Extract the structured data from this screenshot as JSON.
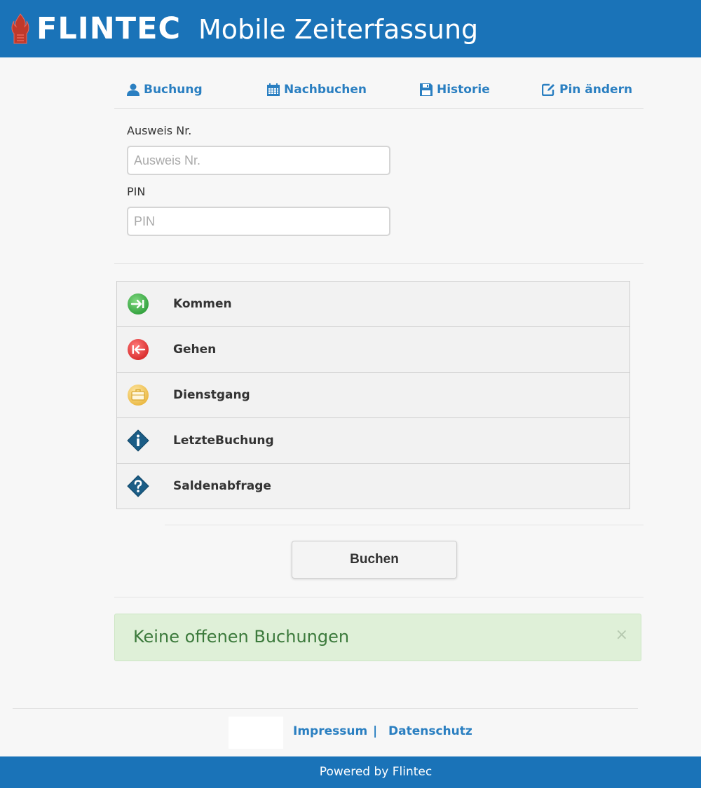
{
  "header": {
    "logo_text": "FLINTEC",
    "title": "Mobile Zeiterfassung",
    "bg_color": "#1a73b8"
  },
  "tabs": [
    {
      "label": "Buchung",
      "icon": "user-icon"
    },
    {
      "label": "Nachbuchen",
      "icon": "calendar-icon"
    },
    {
      "label": "Historie",
      "icon": "save-icon"
    },
    {
      "label": "Pin ändern",
      "icon": "edit-icon"
    }
  ],
  "form": {
    "ausweis": {
      "label": "Ausweis Nr.",
      "placeholder": "Ausweis Nr.",
      "value": ""
    },
    "pin": {
      "label": "PIN",
      "placeholder": "PIN",
      "value": ""
    }
  },
  "options": [
    {
      "label": "Kommen",
      "icon": "arrow-in-icon",
      "color": "#3fae49"
    },
    {
      "label": "Gehen",
      "icon": "arrow-out-icon",
      "color": "#e53935"
    },
    {
      "label": "Dienstgang",
      "icon": "briefcase-icon",
      "color": "#f0c24f"
    },
    {
      "label": "LetzteBuchung",
      "icon": "info-icon",
      "color": "#1b5d86"
    },
    {
      "label": "Saldenabfrage",
      "icon": "question-icon",
      "color": "#1b5d86"
    }
  ],
  "submit_label": "Buchen",
  "alert": {
    "text": "Keine offenen Buchungen",
    "close": "×",
    "color": "#dff0d8"
  },
  "footer": {
    "impressum": "Impressum",
    "separator": "|",
    "datenschutz": "Datenschutz",
    "powered_by": "Powered by Flintec"
  },
  "accent_color": "#2a7fc1"
}
